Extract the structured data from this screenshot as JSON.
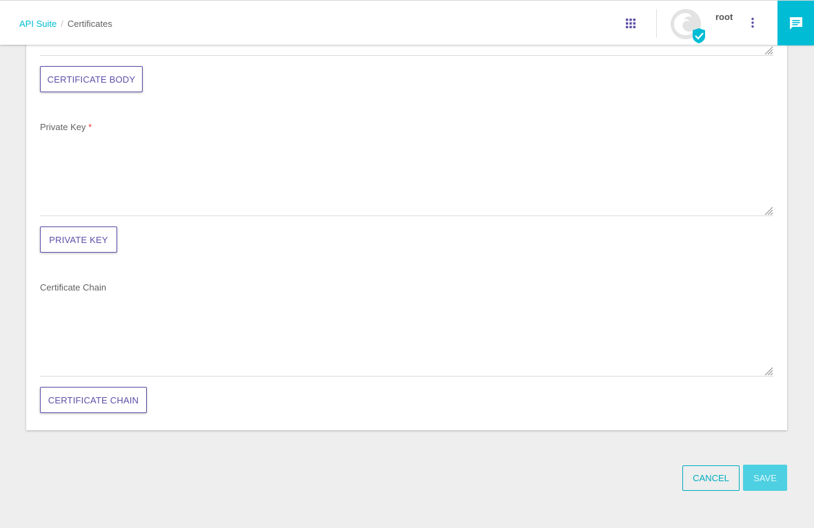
{
  "header": {
    "breadcrumb": {
      "root": "API Suite",
      "separator": "/",
      "current": "Certificates"
    },
    "apps_icon": "apps-grid-icon",
    "user": {
      "name": "root",
      "avatar_icon": "avatar-logo-icon",
      "verified_icon": "verified-badge-icon"
    },
    "menu_icon": "more-vert-icon",
    "chat_icon": "chat-icon"
  },
  "form": {
    "certificate_body": {
      "button_label": "CERTIFICATE BODY"
    },
    "private_key": {
      "label": "Private Key",
      "required_mark": "*",
      "value": "",
      "button_label": "PRIVATE KEY"
    },
    "certificate_chain": {
      "label": "Certificate Chain",
      "value": "",
      "button_label": "CERTIFICATE CHAIN"
    }
  },
  "actions": {
    "cancel_label": "CANCEL",
    "save_label": "SAVE"
  },
  "colors": {
    "accent": "#00bcd4",
    "primary_purple": "#5c4fa8",
    "save_disabled": "#4dd0e1",
    "required": "#e53935"
  }
}
